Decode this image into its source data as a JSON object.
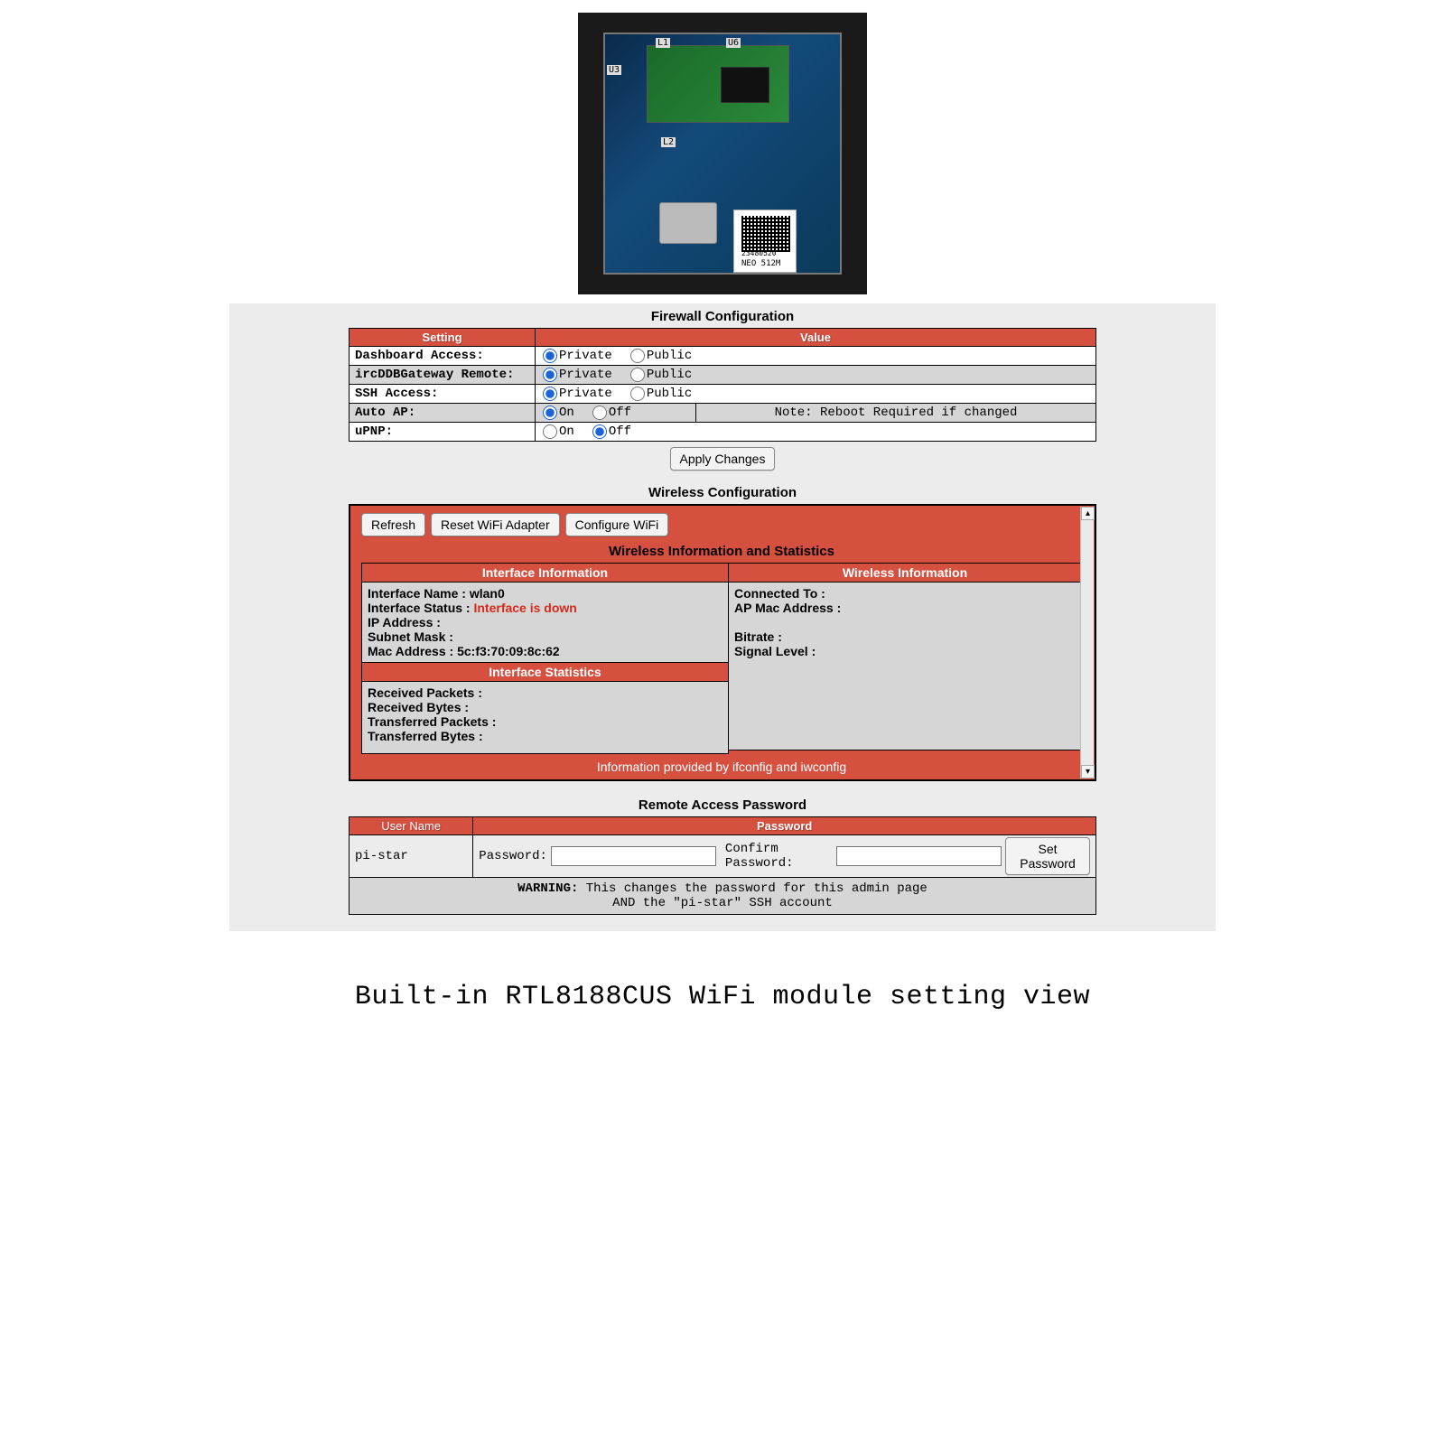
{
  "photo": {
    "qr_serial": "23480520",
    "qr_model": "NEO 512M",
    "labels": {
      "l1": "L1",
      "u6": "U6",
      "u3": "U3",
      "l2": "L2"
    }
  },
  "firewall": {
    "title": "Firewall Configuration",
    "headers": {
      "setting": "Setting",
      "value": "Value"
    },
    "private": "Private",
    "public": "Public",
    "on": "On",
    "off": "Off",
    "rows": {
      "dashboard": {
        "label": "Dashboard Access:",
        "selected": "private"
      },
      "ircddb": {
        "label": "ircDDBGateway Remote:",
        "selected": "private"
      },
      "ssh": {
        "label": "SSH Access:",
        "selected": "private"
      },
      "autoap": {
        "label": "Auto AP:",
        "selected": "on",
        "note": "Note: Reboot Required if changed"
      },
      "upnp": {
        "label": "uPNP:",
        "selected": "off"
      }
    },
    "apply": "Apply Changes"
  },
  "wireless": {
    "title": "Wireless Configuration",
    "buttons": {
      "refresh": "Refresh",
      "reset": "Reset WiFi Adapter",
      "configure": "Configure WiFi"
    },
    "subheading": "Wireless Information and Statistics",
    "iface_info_header": "Interface Information",
    "wireless_info_header": "Wireless Information",
    "iface_stats_header": "Interface Statistics",
    "iface": {
      "name_label": "Interface Name : ",
      "name_value": "wlan0",
      "status_label": "Interface Status : ",
      "status_value": "Interface is down",
      "ip_label": "IP Address :",
      "subnet_label": "Subnet Mask :",
      "mac_label": "Mac Address : ",
      "mac_value": "5c:f3:70:09:8c:62"
    },
    "wifi": {
      "connected_label": "Connected To :",
      "apmac_label": "AP Mac Address :",
      "bitrate_label": "Bitrate :",
      "signal_label": "Signal Level :"
    },
    "stats": {
      "rx_packets": "Received Packets :",
      "rx_bytes": "Received Bytes :",
      "tx_packets": "Transferred Packets :",
      "tx_bytes": "Transferred Bytes :"
    },
    "footer": "Information provided by ifconfig and iwconfig"
  },
  "remote": {
    "title": "Remote Access Password",
    "headers": {
      "user": "User Name",
      "password": "Password"
    },
    "user": "pi-star",
    "password_label": "Password:",
    "confirm_label": "Confirm Password:",
    "set_btn": "Set Password",
    "warning_label": "WARNING:",
    "warning_line1": " This changes the password for this admin page",
    "warning_line2": "AND the \"pi-star\" SSH account"
  },
  "caption": "Built-in RTL8188CUS WiFi module setting view"
}
